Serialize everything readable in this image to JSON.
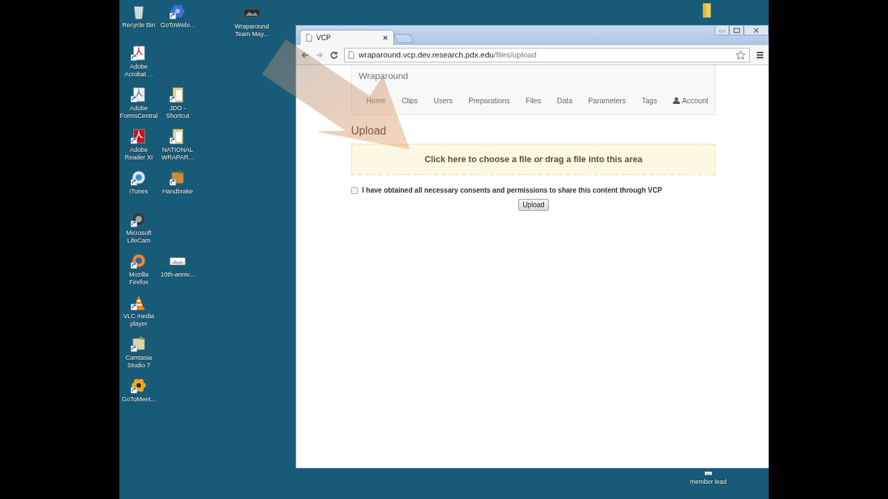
{
  "desktop": {
    "icon_rows": [
      {
        "left": {
          "label": "Recycle Bin",
          "kind": "recycle-bin",
          "shortcut": false
        },
        "right": {
          "label": "GoToWebi...",
          "kind": "webinar",
          "shortcut": true
        }
      },
      {
        "left": {
          "label": "Adobe Acrobat ...",
          "kind": "acrobat",
          "shortcut": true
        }
      },
      {
        "left": {
          "label": "Adobe FormsCentral",
          "kind": "forms",
          "shortcut": true
        },
        "right": {
          "label": "JDO - Shortcut",
          "kind": "document-folder",
          "shortcut": true
        }
      },
      {
        "left": {
          "label": "Adobe Reader XI",
          "kind": "reader",
          "shortcut": true
        },
        "right": {
          "label": "NATIONAL WRAPAR...",
          "kind": "document-folder",
          "shortcut": true
        }
      },
      {
        "left": {
          "label": "iTunes",
          "kind": "itunes",
          "shortcut": true
        },
        "right": {
          "label": "Handbrake",
          "kind": "handbrake",
          "shortcut": true
        }
      },
      {
        "left": {
          "label": "Microsoft LifeCam",
          "kind": "lifecam",
          "shortcut": true
        }
      },
      {
        "left": {
          "label": "Mozilla Firefox",
          "kind": "firefox",
          "shortcut": true
        },
        "right": {
          "label": "10th-anniv...",
          "kind": "image",
          "shortcut": false
        }
      },
      {
        "left": {
          "label": "VLC media player",
          "kind": "vlc",
          "shortcut": true
        }
      },
      {
        "left": {
          "label": "Camtasia Studio 7",
          "kind": "camtasia",
          "shortcut": true
        }
      },
      {
        "left": {
          "label": "GoToMeet...",
          "kind": "meeting",
          "shortcut": true
        }
      }
    ],
    "free_icons": [
      {
        "label": "Wraparound Team May...",
        "kind": "video"
      },
      {
        "kind": "folder"
      },
      {
        "label": "member lead",
        "kind": "image"
      }
    ]
  },
  "browser": {
    "tabs": [
      {
        "title": "VCP",
        "selected": true
      }
    ],
    "address": {
      "host": "wraparound.vcp.dev.research.pdx.edu",
      "path": "/files/upload"
    },
    "back_disabled": false,
    "forward_disabled": true
  },
  "page": {
    "brand": "Wraparound",
    "nav": [
      {
        "label": "Home",
        "kind": "link"
      },
      {
        "label": "Clips",
        "kind": "link"
      },
      {
        "label": "Users",
        "kind": "link"
      },
      {
        "label": "Preparations",
        "kind": "link"
      },
      {
        "label": "Files",
        "kind": "link"
      },
      {
        "label": "Data",
        "kind": "link"
      },
      {
        "label": "Parameters",
        "kind": "link"
      },
      {
        "label": "Tags",
        "kind": "link"
      },
      {
        "label": "Account",
        "kind": "account"
      }
    ],
    "heading": "Upload",
    "drop_zone": "Click here to choose a file *or* drag a file into this area",
    "consent": {
      "label": "I have obtained all necessary consents and permissions to share this content through VCP",
      "checked": false
    },
    "submit": "Upload"
  }
}
